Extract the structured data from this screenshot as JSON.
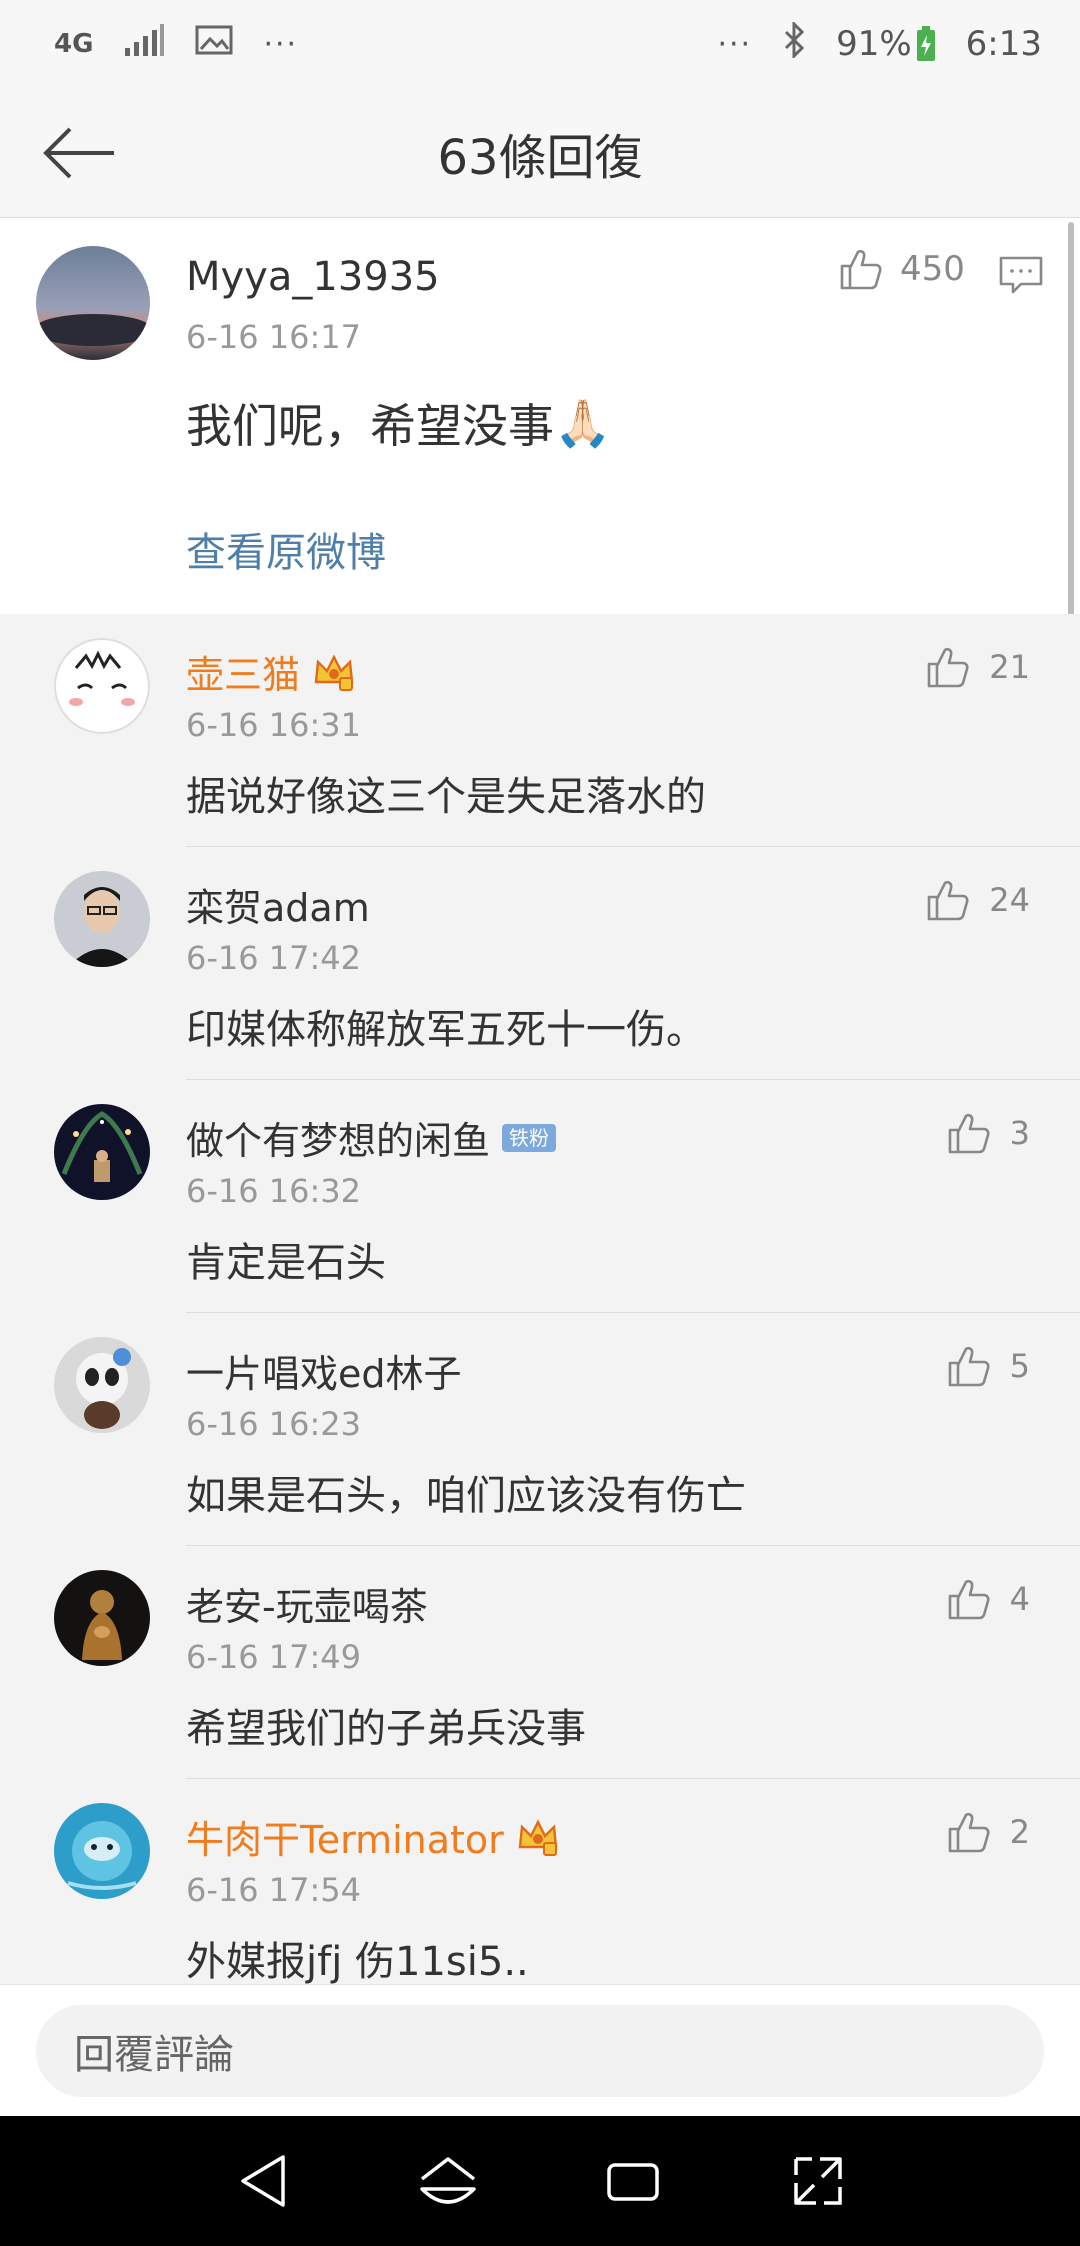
{
  "status_bar": {
    "network": "4G",
    "more": "···",
    "more_right": "···",
    "battery": "91%",
    "time": "6:13"
  },
  "header": {
    "title": "63條回復"
  },
  "original_comment": {
    "username": "Myya_13935",
    "time": "6-16 16:17",
    "text": "我们呢，希望没事",
    "emoji": "🙏🏻",
    "likes": "450",
    "view_original_label": "查看原微博"
  },
  "replies": [
    {
      "username": "壶三猫",
      "vip": true,
      "time": "6-16 16:31",
      "text": "据说好像这三个是失足落水的",
      "likes": "21"
    },
    {
      "username": "栾贺adam",
      "vip": false,
      "time": "6-16 17:42",
      "text": "印媒体称解放军五死十一伤。",
      "likes": "24"
    },
    {
      "username": "做个有梦想的闲鱼",
      "vip": false,
      "badge": "铁粉",
      "time": "6-16 16:32",
      "text": "肯定是石头",
      "likes": "3"
    },
    {
      "username": "一片唱戏ed林子",
      "vip": false,
      "time": "6-16 16:23",
      "text": "如果是石头，咱们应该没有伤亡",
      "likes": "5"
    },
    {
      "username": "老安-玩壶喝茶",
      "vip": false,
      "time": "6-16 17:49",
      "text": "希望我们的子弟兵没事",
      "likes": "4"
    },
    {
      "username": "牛肉干Terminator",
      "vip": true,
      "time": "6-16 17:54",
      "text": "外媒报jfj 伤11si5..",
      "likes": "2"
    }
  ],
  "input": {
    "placeholder": "回覆評論"
  },
  "colors": {
    "vip_name": "#f07c1e",
    "link": "#4f7fa8",
    "badge_fan": "#7ea9dd"
  }
}
